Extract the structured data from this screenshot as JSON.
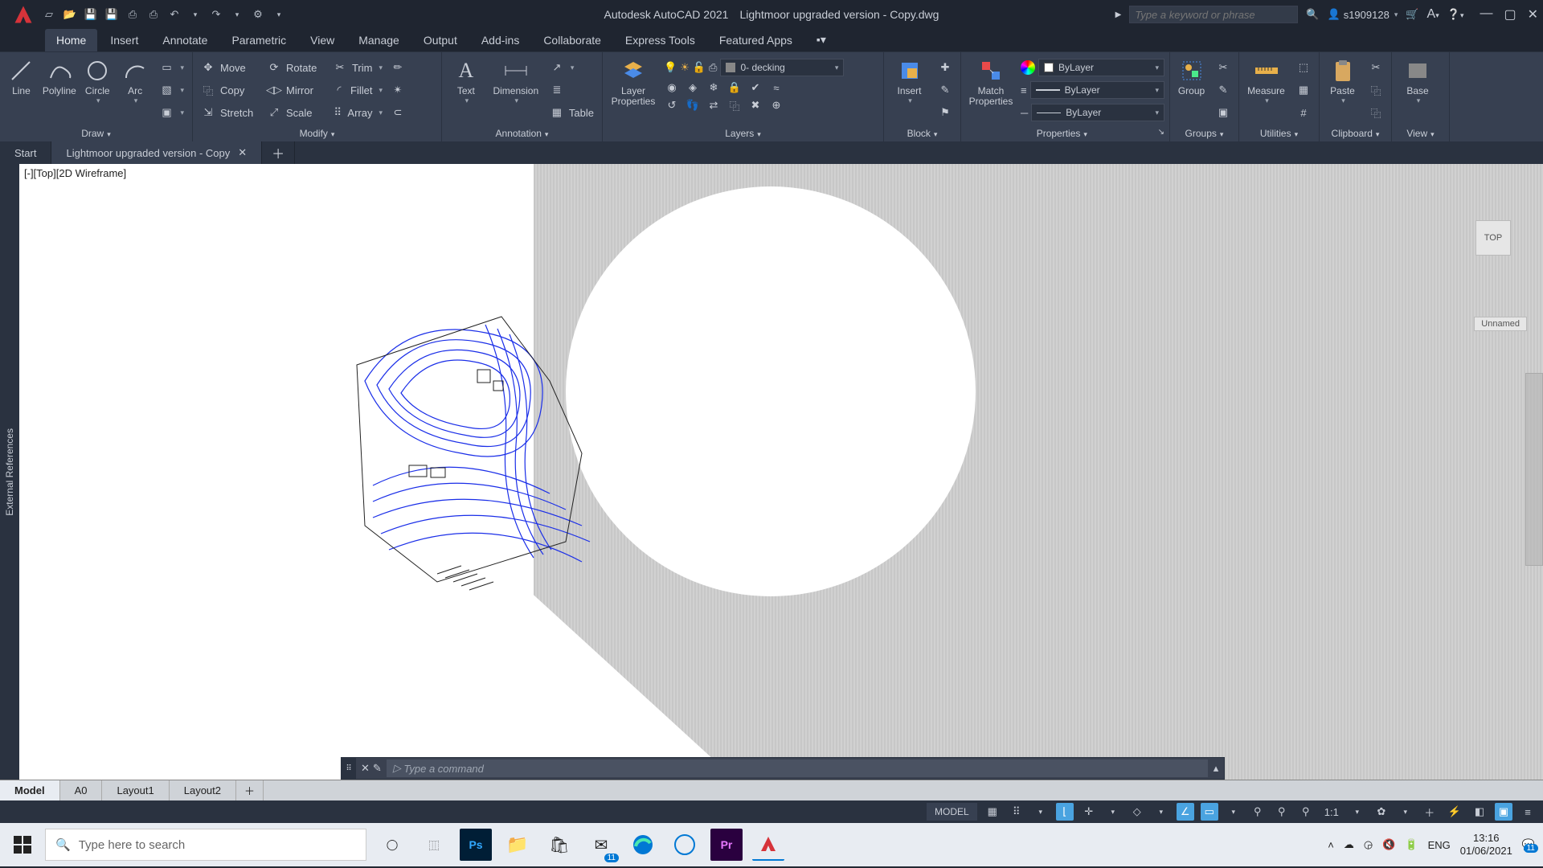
{
  "title": {
    "app": "Autodesk AutoCAD 2021",
    "file": "Lightmoor upgraded version - Copy.dwg"
  },
  "search_placeholder": "Type a keyword or phrase",
  "username": "s1909128",
  "ribbon_tabs": [
    "Home",
    "Insert",
    "Annotate",
    "Parametric",
    "View",
    "Manage",
    "Output",
    "Add-ins",
    "Collaborate",
    "Express Tools",
    "Featured Apps"
  ],
  "active_ribbon_tab": "Home",
  "panels": {
    "draw": {
      "label": "Draw",
      "btns": [
        "Line",
        "Polyline",
        "Circle",
        "Arc"
      ]
    },
    "modify": {
      "label": "Modify",
      "row1": [
        "Move",
        "Rotate",
        "Trim"
      ],
      "row2": [
        "Copy",
        "Mirror",
        "Fillet"
      ],
      "row3": [
        "Stretch",
        "Scale",
        "Array"
      ]
    },
    "annotation": {
      "label": "Annotation",
      "text": "Text",
      "dim": "Dimension",
      "table": "Table"
    },
    "layers": {
      "label": "Layers",
      "big": "Layer\nProperties",
      "current": "0- decking"
    },
    "block": {
      "label": "Block",
      "big": "Insert"
    },
    "properties": {
      "label": "Properties",
      "match": "Match\nProperties",
      "color": "ByLayer",
      "lw": "ByLayer",
      "lt": "ByLayer"
    },
    "groups": {
      "label": "Groups",
      "big": "Group"
    },
    "utilities": {
      "label": "Utilities",
      "big": "Measure"
    },
    "clipboard": {
      "label": "Clipboard",
      "big": "Paste"
    },
    "view": {
      "label": "View",
      "big": "Base"
    }
  },
  "file_tabs": {
    "start": "Start",
    "active": "Lightmoor upgraded version - Copy"
  },
  "sidebar_left": "External References",
  "viewport_label": "[-][Top][2D Wireframe]",
  "viewcube": "TOP",
  "wcs": "Unnamed",
  "cmd_placeholder": "Type a command",
  "layout_tabs": [
    "Model",
    "A0",
    "Layout1",
    "Layout2"
  ],
  "status": {
    "model": "MODEL",
    "scale": "1:1"
  },
  "taskbar": {
    "search": "Type here to search",
    "lang": "ENG",
    "time": "13:16",
    "date": "01/06/2021",
    "mail_badge": "11",
    "action_badge": "11"
  }
}
